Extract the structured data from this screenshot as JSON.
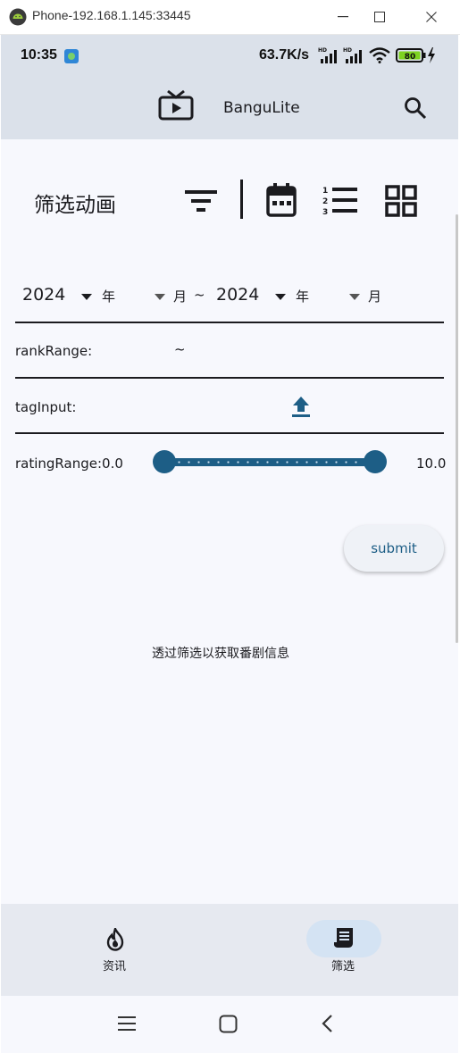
{
  "window": {
    "title": "Phone-192.168.1.145:33445",
    "minimize": "—",
    "maximize": "☐",
    "close": "✕"
  },
  "status": {
    "time": "10:35",
    "net_speed": "63.7K/s",
    "hd1": "HD",
    "hd2": "HD",
    "battery": "80"
  },
  "appbar": {
    "title": "BanguLite"
  },
  "filter": {
    "heading": "筛选动画",
    "start_year": "2024",
    "year_label_1": "年",
    "month_label_1": "月",
    "range_sep": "~",
    "end_year": "2024",
    "year_label_2": "年",
    "month_label_2": "月",
    "rank_label": "rankRange:",
    "rank_sep": "~",
    "tag_label": "tagInput:",
    "rating_label": "ratingRange:0.0",
    "rating_max_label": "10.0",
    "rating_min": 0.0,
    "rating_max": 10.0,
    "submit": "submit",
    "hint": "透过筛选以获取番剧信息"
  },
  "nav": {
    "items": [
      {
        "label": "资讯"
      },
      {
        "label": "筛选"
      }
    ],
    "selected": 1
  },
  "colors": {
    "accent": "#1d5e86",
    "bar": "#dbe1ea",
    "nav": "#e6e9f0",
    "pill": "#d4e3f3"
  }
}
